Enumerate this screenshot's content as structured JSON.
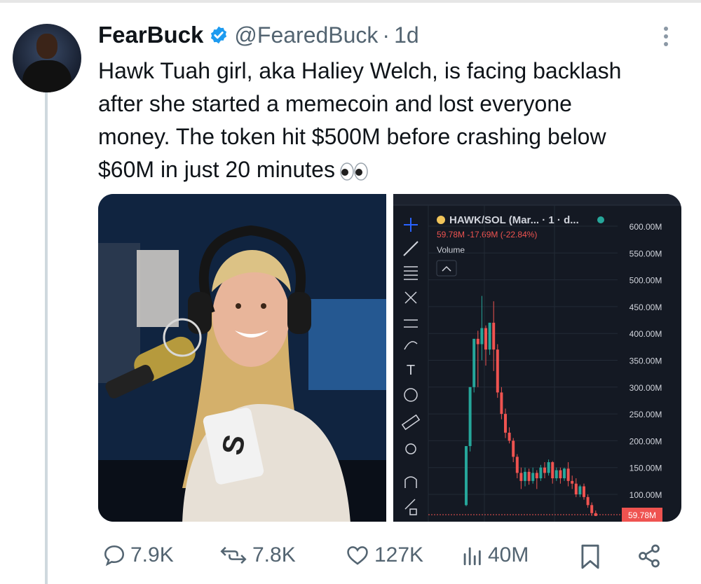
{
  "tweet": {
    "author_name": "FearBuck",
    "handle": "@FearedBuck",
    "separator": "·",
    "time": "1d",
    "text_lines": [
      "Hawk Tuah girl, aka Haliey Welch, is facing backlash",
      "after she started a memecoin and lost everyone",
      "money. The token hit $500M before crashing below",
      "$60M in just 20 minutes"
    ],
    "emoji": "eyes-emoji"
  },
  "chart": {
    "pair_title": "HAWK/SOL (Mar... · 1 · d...",
    "price_line": "59.78M -17.69M (-22.84%)",
    "volume_label": "Volume",
    "y_ticks": [
      "600.00M",
      "550.00M",
      "500.00M",
      "450.00M",
      "400.00M",
      "350.00M",
      "300.00M",
      "250.00M",
      "200.00M",
      "150.00M",
      "100.00M"
    ],
    "current_price_label": "59.78M",
    "colors": {
      "up": "#26a69a",
      "down": "#ef5350",
      "bg": "#141923",
      "grid": "#222a36",
      "axis_text": "#d1d4dc"
    }
  },
  "chart_data": {
    "type": "candlestick",
    "title": "HAWK/SOL",
    "ylim": [
      80,
      620
    ],
    "candles": [
      {
        "o": 80,
        "h": 190,
        "l": 78,
        "c": 190
      },
      {
        "o": 190,
        "h": 300,
        "l": 180,
        "c": 300
      },
      {
        "o": 300,
        "h": 390,
        "l": 290,
        "c": 390
      },
      {
        "o": 390,
        "h": 405,
        "l": 300,
        "c": 380
      },
      {
        "o": 380,
        "h": 470,
        "l": 350,
        "c": 410
      },
      {
        "o": 410,
        "h": 415,
        "l": 340,
        "c": 370
      },
      {
        "o": 370,
        "h": 420,
        "l": 360,
        "c": 420
      },
      {
        "o": 420,
        "h": 460,
        "l": 330,
        "c": 370
      },
      {
        "o": 370,
        "h": 380,
        "l": 280,
        "c": 290
      },
      {
        "o": 290,
        "h": 300,
        "l": 240,
        "c": 250
      },
      {
        "o": 250,
        "h": 260,
        "l": 205,
        "c": 215
      },
      {
        "o": 215,
        "h": 225,
        "l": 195,
        "c": 200
      },
      {
        "o": 200,
        "h": 205,
        "l": 160,
        "c": 170
      },
      {
        "o": 170,
        "h": 175,
        "l": 130,
        "c": 140
      },
      {
        "o": 140,
        "h": 150,
        "l": 110,
        "c": 125
      },
      {
        "o": 125,
        "h": 150,
        "l": 115,
        "c": 142
      },
      {
        "o": 142,
        "h": 148,
        "l": 118,
        "c": 125
      },
      {
        "o": 125,
        "h": 150,
        "l": 120,
        "c": 140
      },
      {
        "o": 140,
        "h": 145,
        "l": 110,
        "c": 130
      },
      {
        "o": 130,
        "h": 155,
        "l": 125,
        "c": 150
      },
      {
        "o": 150,
        "h": 160,
        "l": 130,
        "c": 140
      },
      {
        "o": 140,
        "h": 165,
        "l": 135,
        "c": 160
      },
      {
        "o": 160,
        "h": 162,
        "l": 120,
        "c": 130
      },
      {
        "o": 130,
        "h": 150,
        "l": 125,
        "c": 145
      },
      {
        "o": 145,
        "h": 150,
        "l": 120,
        "c": 130
      },
      {
        "o": 130,
        "h": 150,
        "l": 125,
        "c": 148
      },
      {
        "o": 148,
        "h": 160,
        "l": 115,
        "c": 125
      },
      {
        "o": 125,
        "h": 135,
        "l": 110,
        "c": 120
      },
      {
        "o": 120,
        "h": 130,
        "l": 95,
        "c": 100
      },
      {
        "o": 100,
        "h": 118,
        "l": 95,
        "c": 115
      },
      {
        "o": 115,
        "h": 120,
        "l": 90,
        "c": 95
      },
      {
        "o": 95,
        "h": 100,
        "l": 75,
        "c": 80
      },
      {
        "o": 80,
        "h": 85,
        "l": 60,
        "c": 65
      },
      {
        "o": 65,
        "h": 70,
        "l": 58,
        "c": 59.78
      }
    ]
  },
  "actions": {
    "replies": "7.9K",
    "reposts": "7.8K",
    "likes": "127K",
    "views": "40M"
  },
  "theme": {
    "verified_blue": "#1d9bf0",
    "muted": "#536471"
  }
}
